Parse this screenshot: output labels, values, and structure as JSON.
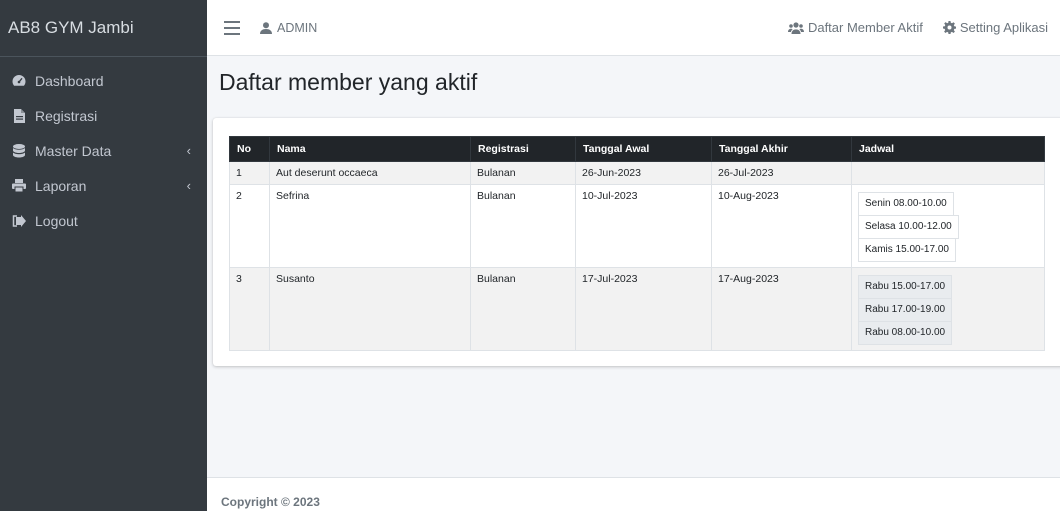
{
  "brand": {
    "title": "AB8 GYM Jambi"
  },
  "sidebar": {
    "items": [
      {
        "label": "Dashboard",
        "icon": "tachometer-icon",
        "has_chevron": false
      },
      {
        "label": "Registrasi",
        "icon": "file-icon",
        "has_chevron": false
      },
      {
        "label": "Master Data",
        "icon": "database-icon",
        "has_chevron": true,
        "chevron": "‹"
      },
      {
        "label": "Laporan",
        "icon": "print-icon",
        "has_chevron": true,
        "chevron": "‹"
      },
      {
        "label": "Logout",
        "icon": "sign-out-icon",
        "has_chevron": false
      }
    ]
  },
  "navbar": {
    "user_label": "ADMIN",
    "links": [
      {
        "label": "Daftar Member Aktif",
        "icon": "users-icon"
      },
      {
        "label": "Setting Aplikasi",
        "icon": "cog-icon"
      }
    ]
  },
  "page": {
    "title": "Daftar member yang aktif"
  },
  "table": {
    "headers": [
      "No",
      "Nama",
      "Registrasi",
      "Tanggal Awal",
      "Tanggal Akhir",
      "Jadwal"
    ],
    "rows": [
      {
        "no": "1",
        "nama": "Aut deserunt occaeca",
        "registrasi": "Bulanan",
        "tanggal_awal": "26-Jun-2023",
        "tanggal_akhir": "26-Jul-2023",
        "jadwal": []
      },
      {
        "no": "2",
        "nama": "Sefrina",
        "registrasi": "Bulanan",
        "tanggal_awal": "10-Jul-2023",
        "tanggal_akhir": "10-Aug-2023",
        "jadwal": [
          "Senin 08.00-10.00",
          "Selasa 10.00-12.00",
          "Kamis 15.00-17.00"
        ]
      },
      {
        "no": "3",
        "nama": "Susanto",
        "registrasi": "Bulanan",
        "tanggal_awal": "17-Jul-2023",
        "tanggal_akhir": "17-Aug-2023",
        "jadwal": [
          "Rabu 15.00-17.00",
          "Rabu 17.00-19.00",
          "Rabu 08.00-10.00"
        ]
      }
    ]
  },
  "footer": {
    "text": "Copyright © 2023"
  },
  "colors": {
    "sidebar_bg": "#343a40",
    "table_header_bg": "#212529",
    "content_bg": "#f4f6f9"
  }
}
